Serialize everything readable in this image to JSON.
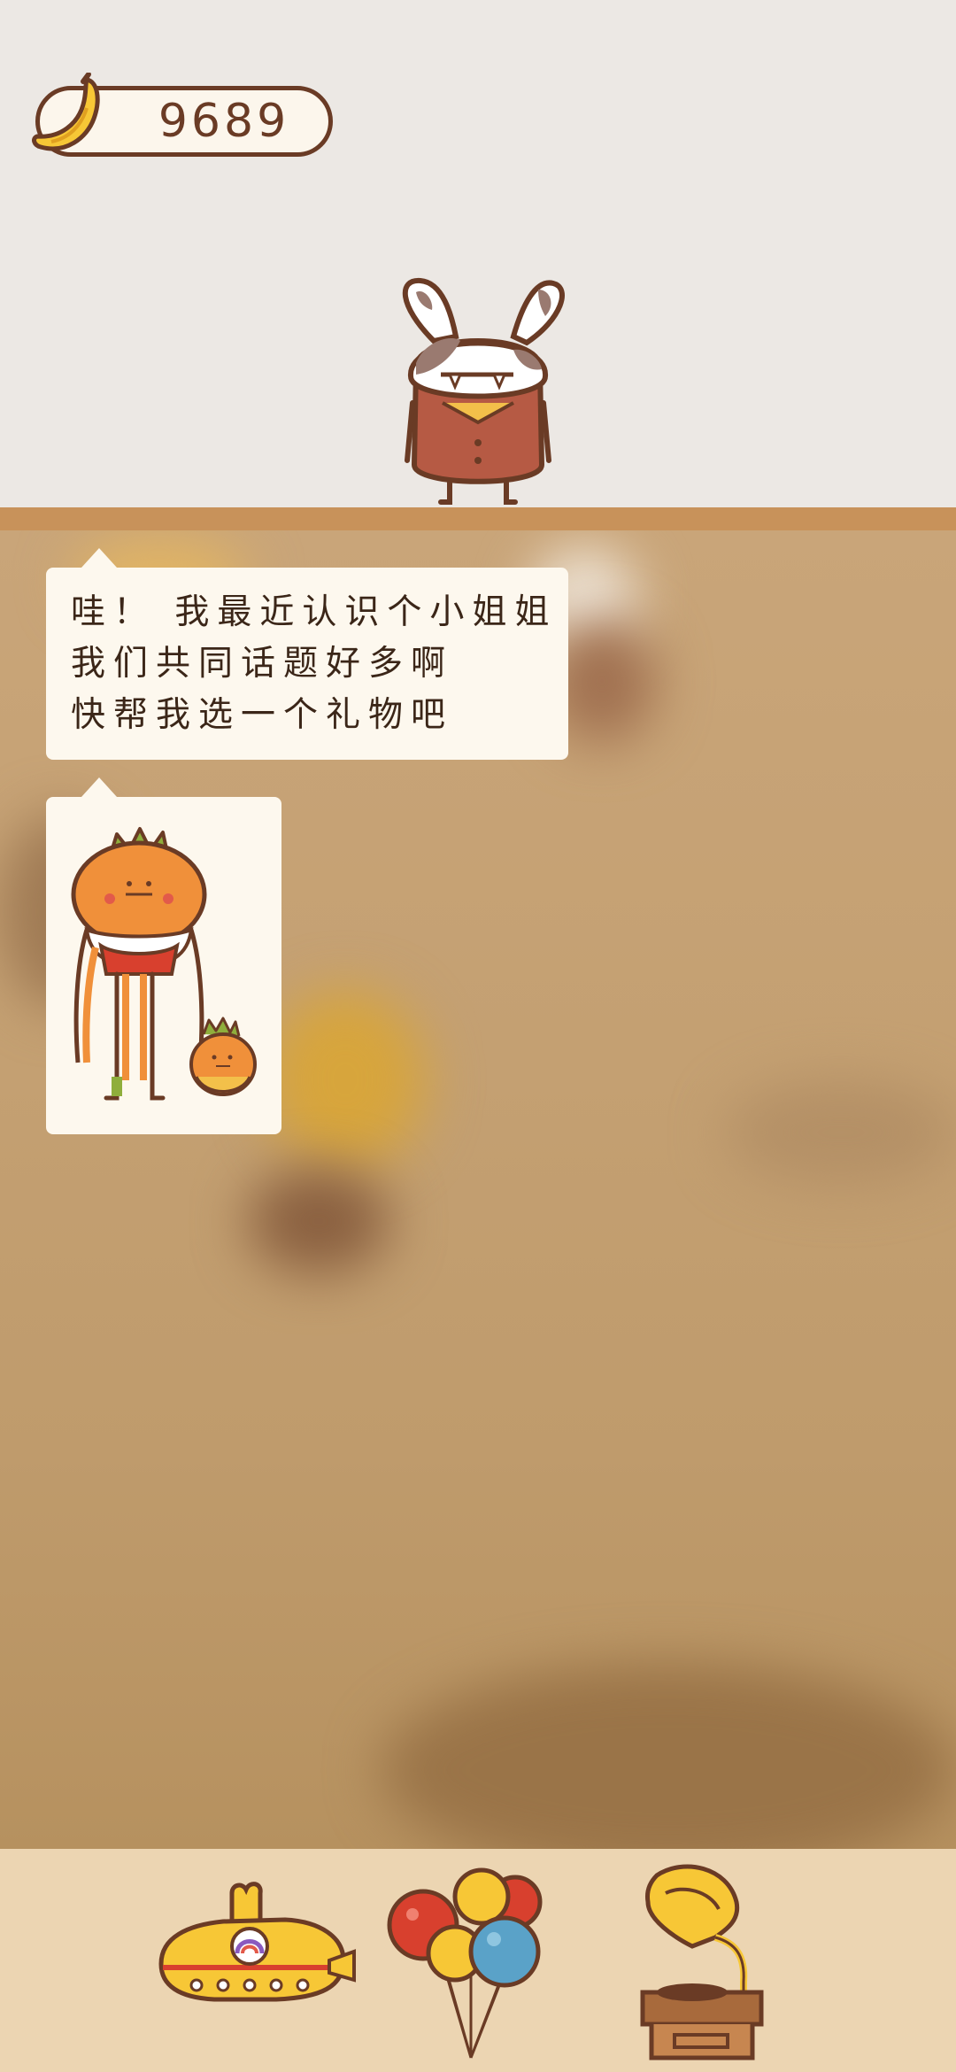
{
  "hud": {
    "coin_icon": "banana-icon",
    "coin_value": "9689"
  },
  "dialog": {
    "speaker": "bunny-character",
    "lines": [
      "哇！ 我最近认识个小姐姐",
      "我们共同话题好多啊",
      "快帮我选一个礼物吧"
    ],
    "image": "orange-character-couple"
  },
  "gifts": [
    {
      "icon": "yellow-submarine-icon"
    },
    {
      "icon": "balloons-icon"
    },
    {
      "icon": "gramophone-icon"
    }
  ],
  "colors": {
    "outline": "#6a3b25",
    "bubble": "#fdf8ee",
    "bottom_bar": "#ecd5b2",
    "shelf": "#c8925a"
  }
}
